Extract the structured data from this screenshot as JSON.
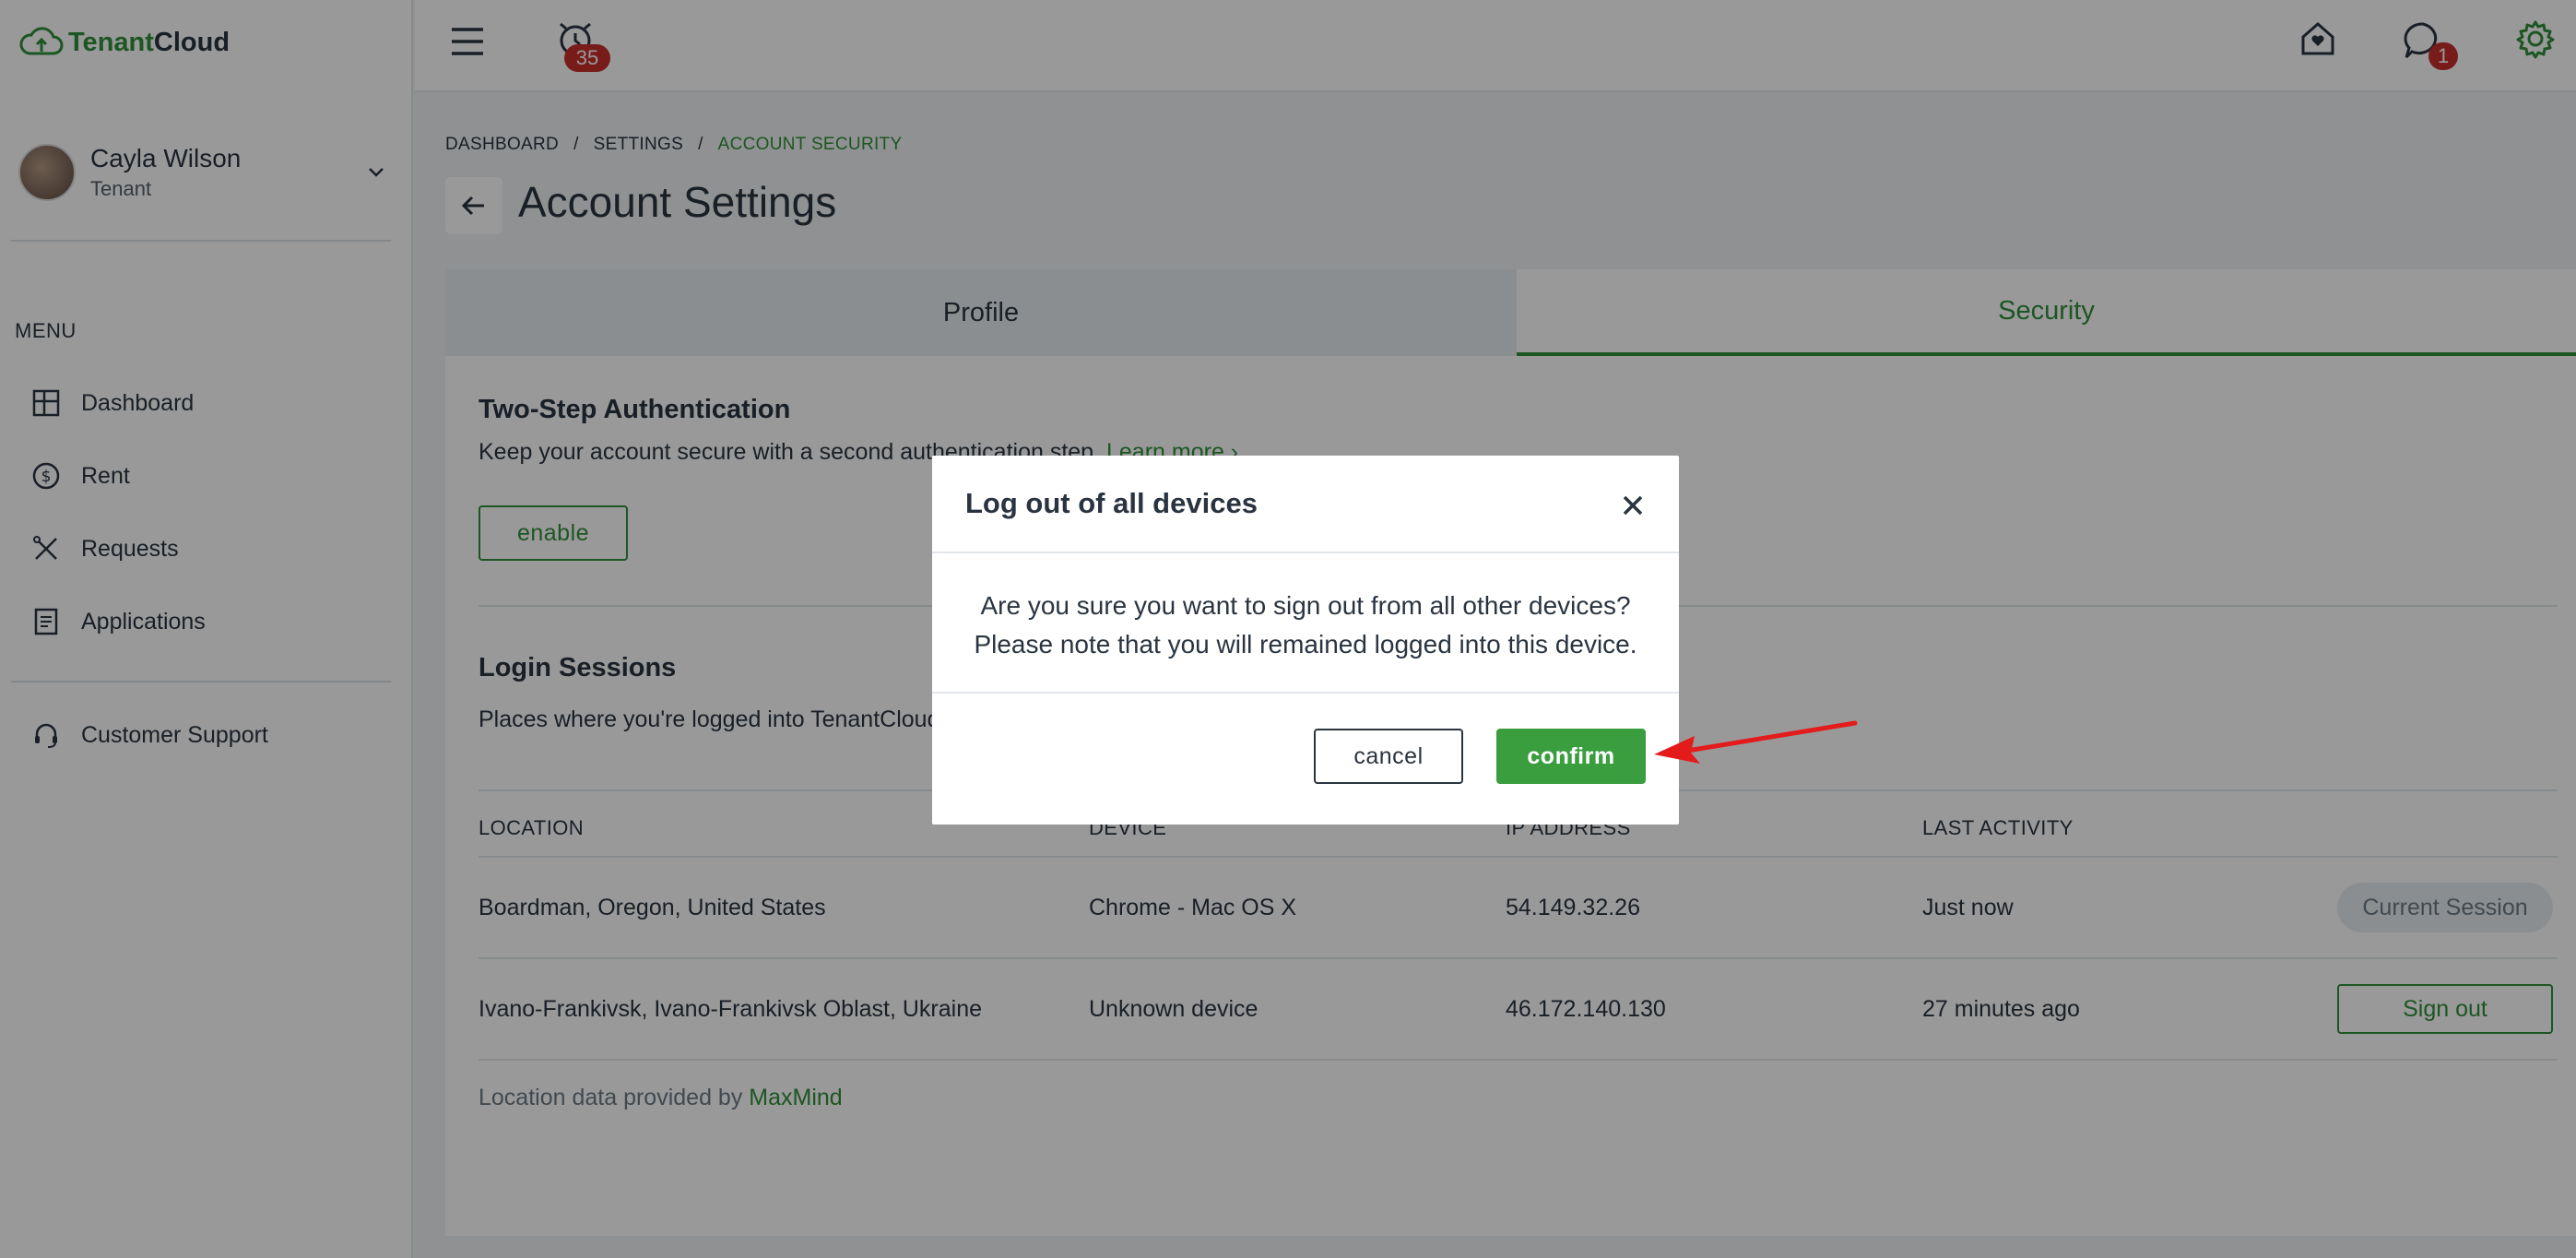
{
  "app": {
    "logo_prefix": "Tenant",
    "logo_suffix": "Cloud",
    "accent_color": "#2f8f3a"
  },
  "user": {
    "name": "Cayla Wilson",
    "role": "Tenant"
  },
  "sidebar": {
    "menu_label": "MENU",
    "items": [
      {
        "label": "Dashboard",
        "icon": "dashboard-grid-icon"
      },
      {
        "label": "Rent",
        "icon": "dollar-circle-icon"
      },
      {
        "label": "Requests",
        "icon": "tools-icon"
      },
      {
        "label": "Applications",
        "icon": "document-icon"
      }
    ],
    "support_label": "Customer Support"
  },
  "topbar": {
    "notification_count": "35",
    "message_count": "1"
  },
  "breadcrumb": [
    "DASHBOARD",
    "/",
    "SETTINGS",
    "/",
    "ACCOUNT SECURITY"
  ],
  "page": {
    "title": "Account Settings",
    "tabs": [
      {
        "label": "Profile",
        "active": false
      },
      {
        "label": "Security",
        "active": true
      }
    ]
  },
  "two_step": {
    "title": "Two-Step Authentication",
    "description": "Keep your account secure with a second authentication step.",
    "link": "Learn more ›",
    "button": "enable"
  },
  "sessions": {
    "title": "Login Sessions",
    "description": "Places where you're logged into TenantCloud",
    "columns": [
      "LOCATION",
      "DEVICE",
      "IP ADDRESS",
      "LAST ACTIVITY"
    ],
    "rows": [
      {
        "location": "Boardman, Oregon, United States",
        "device": "Chrome - Mac OS X",
        "ip": "54.149.32.26",
        "last_activity": "Just now",
        "action": "Current Session"
      },
      {
        "location": "Ivano-Frankivsk, Ivano-Frankivsk Oblast, Ukraine",
        "device": "Unknown device",
        "ip": "46.172.140.130",
        "last_activity": "27 minutes ago",
        "action": "Sign out"
      }
    ],
    "footnote_prefix": "Location data provided by",
    "footnote_link": "MaxMind"
  },
  "modal": {
    "title": "Log out of all devices",
    "body_line1": "Are you sure you want to sign out from all other devices?",
    "body_line2": "Please note that you will remained logged into this device.",
    "cancel": "cancel",
    "confirm": "confirm"
  }
}
